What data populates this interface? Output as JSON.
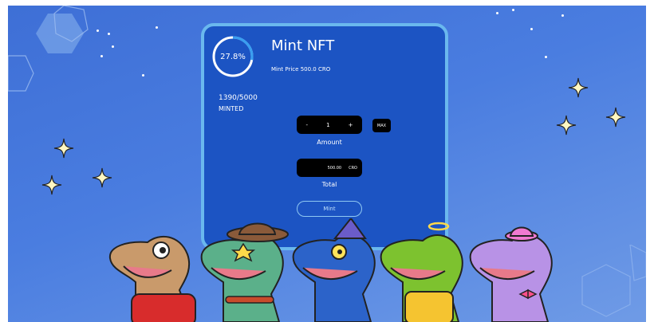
{
  "mint": {
    "title": "Mint NFT",
    "price_text": "Mint Price 500.0 CRO",
    "progress_text": "27.8%",
    "progress_fraction": 0.278,
    "minted_count": "1390/5000",
    "minted_label": "MINTED"
  },
  "amount": {
    "minus_label": "-",
    "value": "1",
    "plus_label": "+",
    "max_label": "MAX",
    "label": "Amount"
  },
  "total": {
    "value": "500.00",
    "currency": "CRO",
    "label": "Total"
  },
  "action": {
    "mint_label": "Mint"
  },
  "colors": {
    "card_bg": "#1c54c3",
    "card_border": "#6ab8ee",
    "ring_accent": "#3a9ef0"
  },
  "icons": [
    "sparkle-icon",
    "hexagon-decoration"
  ]
}
